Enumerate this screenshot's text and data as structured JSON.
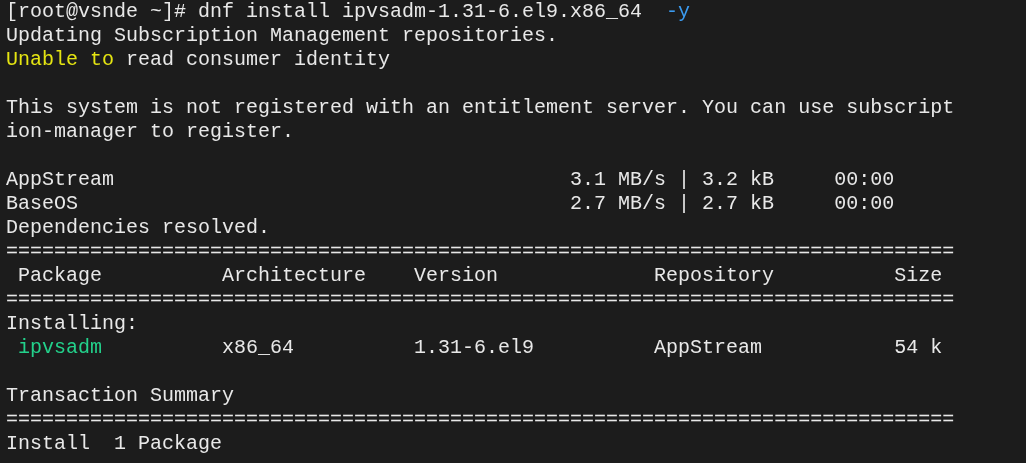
{
  "terminal": {
    "lines": [
      {
        "kind": "text",
        "segments": [
          {
            "text": "[root@vsnde ~]# dnf install ipvsadm-1.31-6.el9.x86_64  "
          },
          {
            "text": "-y",
            "color": "#3b9bf0"
          }
        ]
      },
      {
        "kind": "text",
        "segments": [
          {
            "text": "Updating Subscription Management repositories."
          }
        ]
      },
      {
        "kind": "text",
        "segments": [
          {
            "text": "Unable to",
            "color": "#e5e512"
          },
          {
            "text": " read consumer identity"
          }
        ]
      },
      {
        "kind": "blank"
      },
      {
        "kind": "text",
        "segments": [
          {
            "text": "This system is not registered with an entitlement server. You can use subscript"
          }
        ]
      },
      {
        "kind": "text",
        "segments": [
          {
            "text": "ion-manager to register."
          }
        ]
      },
      {
        "kind": "blank"
      },
      {
        "kind": "text",
        "segments": [
          {
            "text": "AppStream                                      3.1 MB/s | 3.2 kB     00:00"
          }
        ]
      },
      {
        "kind": "text",
        "segments": [
          {
            "text": "BaseOS                                         2.7 MB/s | 2.7 kB     00:00"
          }
        ]
      },
      {
        "kind": "text",
        "segments": [
          {
            "text": "Dependencies resolved."
          }
        ]
      },
      {
        "kind": "text",
        "segments": [
          {
            "text": "==============================================================================="
          }
        ]
      },
      {
        "kind": "text",
        "segments": [
          {
            "text": " Package          Architecture    Version             Repository          Size"
          }
        ]
      },
      {
        "kind": "text",
        "segments": [
          {
            "text": "==============================================================================="
          }
        ]
      },
      {
        "kind": "text",
        "segments": [
          {
            "text": "Installing:"
          }
        ]
      },
      {
        "kind": "text",
        "segments": [
          {
            "text": " ipvsadm",
            "color": "#23d18b"
          },
          {
            "text": "          x86_64          1.31-6.el9          AppStream           54 k"
          }
        ]
      },
      {
        "kind": "blank"
      },
      {
        "kind": "text",
        "segments": [
          {
            "text": "Transaction Summary"
          }
        ]
      },
      {
        "kind": "text",
        "segments": [
          {
            "text": "==============================================================================="
          }
        ]
      },
      {
        "kind": "text",
        "segments": [
          {
            "text": "Install  1 Package"
          }
        ]
      }
    ]
  }
}
